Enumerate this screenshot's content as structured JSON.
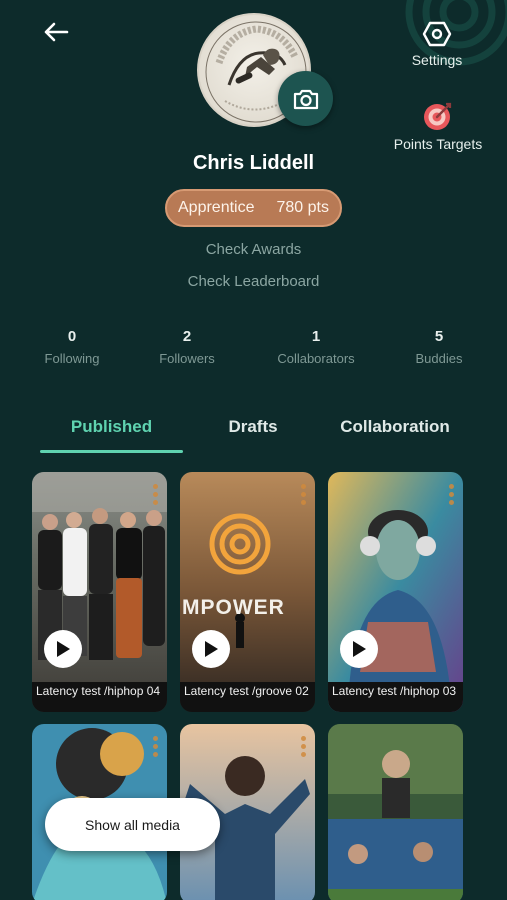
{
  "header": {
    "back_icon": "arrow-left-icon",
    "settings_label": "Settings",
    "settings_icon": "hexagon-nut-icon",
    "points_label": "Points Targets",
    "points_icon": "target-dart-icon",
    "camera_icon": "camera-icon"
  },
  "profile": {
    "name": "Chris Liddell",
    "rank": "Apprentice",
    "points": "780 pts",
    "check_awards": "Check Awards",
    "check_leaderboard": "Check Leaderboard"
  },
  "stats": [
    {
      "value": "0",
      "label": "Following"
    },
    {
      "value": "2",
      "label": "Followers"
    },
    {
      "value": "1",
      "label": "Collaborators"
    },
    {
      "value": "5",
      "label": "Buddies"
    }
  ],
  "tabs": [
    {
      "label": "Published"
    },
    {
      "label": "Drafts"
    },
    {
      "label": "Collaboration"
    }
  ],
  "media": [
    {
      "caption": "Latency test /hiphop 04"
    },
    {
      "caption": "Latency test /groove 02",
      "overlay_text": "MPOWER"
    },
    {
      "caption": "Latency test /hiphop 03"
    },
    {
      "caption": ""
    },
    {
      "caption": ""
    },
    {
      "caption": ""
    }
  ],
  "show_all_label": "Show all media",
  "colors": {
    "background": "#0d2b2b",
    "accent": "#5fd3b0",
    "rank_pill": "#b87a55",
    "camera_button": "#1d5450"
  }
}
